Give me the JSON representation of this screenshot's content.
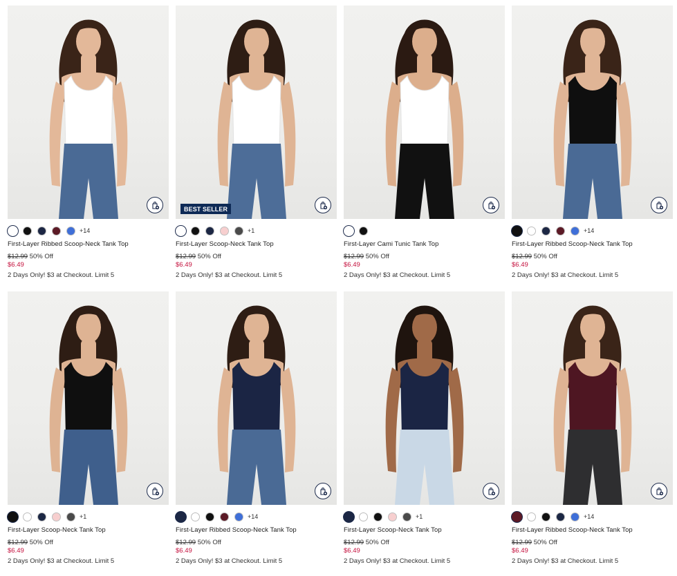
{
  "products": [
    {
      "name": "First-Layer Ribbed Scoop-Neck Tank Top",
      "orig_price": "$12.99",
      "discount": "50% Off",
      "sale_price": "$6.49",
      "promo": "2 Days Only! $3 at Checkout. Limit 5",
      "badge": "",
      "swatches": [
        "#ffffff",
        "#111111",
        "#1c2744",
        "#5c1a26",
        "#3f6fd8"
      ],
      "more_colors": "+14",
      "top_color": "#ffffff",
      "bottom_color": "#4a6a95",
      "skin": "#e3b899",
      "hair": "#3a2418"
    },
    {
      "name": "First-Layer Scoop-Neck Tank Top",
      "orig_price": "$12.99",
      "discount": "50% Off",
      "sale_price": "$6.49",
      "promo": "2 Days Only! $3 at Checkout. Limit 5",
      "badge": "BEST SELLER",
      "swatches": [
        "#ffffff",
        "#111111",
        "#1c2744",
        "#f7cfcf",
        "#4a4a4a"
      ],
      "more_colors": "+1",
      "top_color": "#ffffff",
      "bottom_color": "#4d6d98",
      "skin": "#dfb494",
      "hair": "#2e1d14"
    },
    {
      "name": "First-Layer Cami Tunic Tank Top",
      "orig_price": "$12.99",
      "discount": "50% Off",
      "sale_price": "$6.49",
      "promo": "2 Days Only! $3 at Checkout. Limit 5",
      "badge": "",
      "swatches": [
        "#ffffff",
        "#111111"
      ],
      "more_colors": "",
      "top_color": "#ffffff",
      "bottom_color": "#111111",
      "skin": "#dcae8c",
      "hair": "#2b1a12"
    },
    {
      "name": "First-Layer Ribbed Scoop-Neck Tank Top",
      "orig_price": "$12.99",
      "discount": "50% Off",
      "sale_price": "$6.49",
      "promo": "2 Days Only! $3 at Checkout. Limit 5",
      "badge": "",
      "swatches": [
        "#111111",
        "#ffffff",
        "#1c2744",
        "#5c1a26",
        "#3f6fd8"
      ],
      "more_colors": "+14",
      "top_color": "#0f0f0f",
      "bottom_color": "#4a6a95",
      "skin": "#e0b596",
      "hair": "#3a2418"
    },
    {
      "name": "First-Layer Scoop-Neck Tank Top",
      "orig_price": "$12.99",
      "discount": "50% Off",
      "sale_price": "$6.49",
      "promo": "2 Days Only! $3 at Checkout. Limit 5",
      "badge": "",
      "swatches": [
        "#111111",
        "#ffffff",
        "#1c2744",
        "#f7cfcf",
        "#4a4a4a"
      ],
      "more_colors": "+1",
      "top_color": "#0f0f0f",
      "bottom_color": "#3f5f8c",
      "skin": "#deb393",
      "hair": "#2e1d14"
    },
    {
      "name": "First-Layer Ribbed Scoop-Neck Tank Top",
      "orig_price": "$12.99",
      "discount": "50% Off",
      "sale_price": "$6.49",
      "promo": "2 Days Only! $3 at Checkout. Limit 5",
      "badge": "",
      "swatches": [
        "#1c2744",
        "#ffffff",
        "#111111",
        "#5c1a26",
        "#3f6fd8"
      ],
      "more_colors": "+14",
      "top_color": "#1b2544",
      "bottom_color": "#4a6a95",
      "skin": "#dfb494",
      "hair": "#2e1d14"
    },
    {
      "name": "First-Layer Scoop-Neck Tank Top",
      "orig_price": "$12.99",
      "discount": "50% Off",
      "sale_price": "$6.49",
      "promo": "2 Days Only! $3 at Checkout. Limit 5",
      "badge": "",
      "swatches": [
        "#1c2744",
        "#ffffff",
        "#111111",
        "#f7cfcf",
        "#4a4a4a"
      ],
      "more_colors": "+1",
      "top_color": "#1b2544",
      "bottom_color": "#c9d8e6",
      "skin": "#a06a48",
      "hair": "#1f140e"
    },
    {
      "name": "First-Layer Ribbed Scoop-Neck Tank Top",
      "orig_price": "$12.99",
      "discount": "50% Off",
      "sale_price": "$6.49",
      "promo": "2 Days Only! $3 at Checkout. Limit 5",
      "badge": "",
      "swatches": [
        "#5c1a26",
        "#ffffff",
        "#111111",
        "#1c2744",
        "#3f6fd8"
      ],
      "more_colors": "+14",
      "top_color": "#4e1622",
      "bottom_color": "#2e2e30",
      "skin": "#dfb494",
      "hair": "#3a2418"
    }
  ]
}
